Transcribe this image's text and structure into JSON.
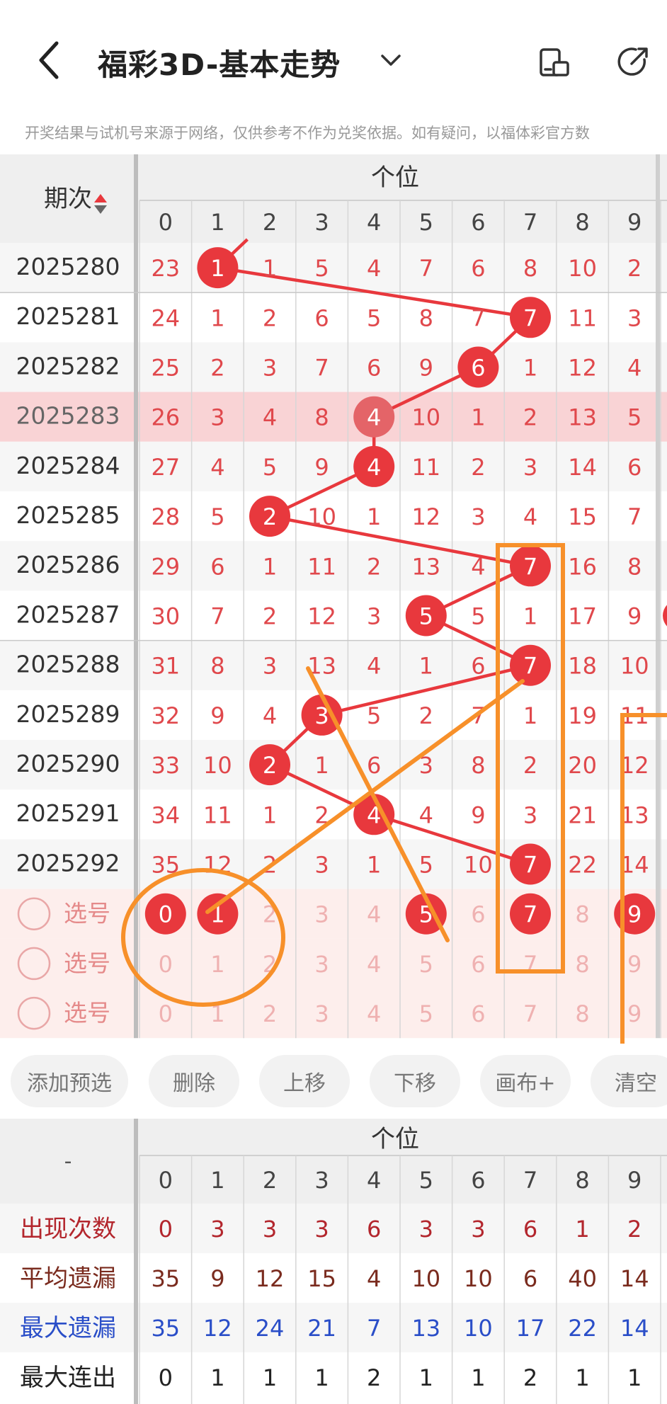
{
  "header": {
    "title": "福彩3D-基本走势",
    "notice": "开奖结果与试机号来源于网络，仅供参考不作为兑奖依据。如有疑问，以福体彩官方数"
  },
  "table": {
    "col_header": "期次",
    "group_header": "个位",
    "digits": [
      "0",
      "1",
      "2",
      "3",
      "4",
      "5",
      "6",
      "7",
      "8",
      "9"
    ],
    "rows": [
      {
        "period": "2025280",
        "cells": [
          "23",
          "1",
          "1",
          "5",
          "4",
          "7",
          "6",
          "8",
          "10",
          "2"
        ],
        "hit": 1
      },
      {
        "period": "2025281",
        "cells": [
          "24",
          "1",
          "2",
          "6",
          "5",
          "8",
          "7",
          "7",
          "11",
          "3"
        ],
        "hit": 7
      },
      {
        "period": "2025282",
        "cells": [
          "25",
          "2",
          "3",
          "7",
          "6",
          "9",
          "6",
          "1",
          "12",
          "4"
        ],
        "hit": 6
      },
      {
        "period": "2025283",
        "cells": [
          "26",
          "3",
          "4",
          "8",
          "4",
          "10",
          "1",
          "2",
          "13",
          "5"
        ],
        "hit": 4
      },
      {
        "period": "2025284",
        "cells": [
          "27",
          "4",
          "5",
          "9",
          "4",
          "11",
          "2",
          "3",
          "14",
          "6"
        ],
        "hit": 4
      },
      {
        "period": "2025285",
        "cells": [
          "28",
          "5",
          "2",
          "10",
          "1",
          "12",
          "3",
          "4",
          "15",
          "7"
        ],
        "hit": 2
      },
      {
        "period": "2025286",
        "cells": [
          "29",
          "6",
          "1",
          "11",
          "2",
          "13",
          "4",
          "7",
          "16",
          "8"
        ],
        "hit": 7
      },
      {
        "period": "2025287",
        "cells": [
          "30",
          "7",
          "2",
          "12",
          "3",
          "5",
          "5",
          "1",
          "17",
          "9"
        ],
        "hit": 5
      },
      {
        "period": "2025288",
        "cells": [
          "31",
          "8",
          "3",
          "13",
          "4",
          "1",
          "6",
          "7",
          "18",
          "10"
        ],
        "hit": 7
      },
      {
        "period": "2025289",
        "cells": [
          "32",
          "9",
          "4",
          "3",
          "5",
          "2",
          "7",
          "1",
          "19",
          "11"
        ],
        "hit": 3
      },
      {
        "period": "2025290",
        "cells": [
          "33",
          "10",
          "2",
          "1",
          "6",
          "3",
          "8",
          "2",
          "20",
          "12"
        ],
        "hit": 2
      },
      {
        "period": "2025291",
        "cells": [
          "34",
          "11",
          "1",
          "2",
          "4",
          "4",
          "9",
          "3",
          "21",
          "13"
        ],
        "hit": 4
      },
      {
        "period": "2025292",
        "cells": [
          "35",
          "12",
          "2",
          "3",
          "1",
          "5",
          "10",
          "7",
          "22",
          "14"
        ],
        "hit": 7
      }
    ],
    "pick_label": "选号",
    "pick_rows": [
      {
        "selected": [
          0,
          1,
          5,
          7,
          9
        ]
      },
      {
        "selected": []
      },
      {
        "selected": []
      }
    ]
  },
  "toolbar": {
    "buttons": [
      "添加预选",
      "删除",
      "上移",
      "下移",
      "画布+",
      "清空"
    ]
  },
  "stats": {
    "corner": "-",
    "group_header": "个位",
    "rows": [
      {
        "label": "出现次数",
        "values": [
          "0",
          "3",
          "3",
          "3",
          "6",
          "3",
          "3",
          "6",
          "1",
          "2"
        ],
        "color": "#b3262d"
      },
      {
        "label": "平均遗漏",
        "values": [
          "35",
          "9",
          "12",
          "15",
          "4",
          "10",
          "10",
          "6",
          "40",
          "14"
        ],
        "color": "#7a2b1e"
      },
      {
        "label": "最大遗漏",
        "values": [
          "35",
          "12",
          "24",
          "21",
          "7",
          "13",
          "10",
          "17",
          "22",
          "14"
        ],
        "color": "#2a4ec8"
      },
      {
        "label": "最大连出",
        "values": [
          "0",
          "1",
          "1",
          "1",
          "2",
          "1",
          "1",
          "2",
          "1",
          "1"
        ],
        "color": "#222222"
      }
    ]
  },
  "colors": {
    "red": "#e8383d",
    "orange": "#f7902a",
    "highlight_row": "#f9d3d5",
    "pick_bg": "#fdeeec"
  }
}
